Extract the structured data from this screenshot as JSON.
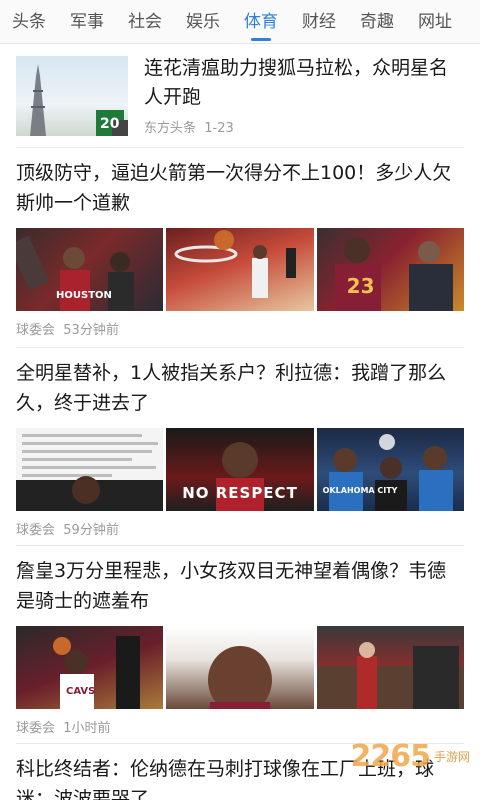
{
  "tabs": [
    {
      "label": "头条",
      "active": false
    },
    {
      "label": "军事",
      "active": false
    },
    {
      "label": "社会",
      "active": false
    },
    {
      "label": "娱乐",
      "active": false
    },
    {
      "label": "体育",
      "active": true
    },
    {
      "label": "财经",
      "active": false
    },
    {
      "label": "奇趣",
      "active": false
    },
    {
      "label": "网址",
      "active": false
    }
  ],
  "articles": [
    {
      "title": "连花清瘟助力搜狐马拉松，众明星名人开跑",
      "source": "东方头条",
      "time": "1-23",
      "thumb_text": "20"
    },
    {
      "title": "顶级防守，逼迫火箭第一次得分不上100！多少人欠斯帅一个道歉",
      "source": "球委会",
      "time": "53分钟前",
      "image_text": [
        "HOUSTON",
        "",
        "23"
      ]
    },
    {
      "title": "全明星替补，1人被指关系户？利拉德：我蹭了那么久，终于进去了",
      "source": "球委会",
      "time": "59分钟前",
      "image_text": [
        "",
        "NO RESPECT",
        "OKLAHOMA CITY"
      ]
    },
    {
      "title": "詹皇3万分里程悲，小女孩双目无神望着偶像？韦德是骑士的遮羞布",
      "source": "球委会",
      "time": "1小时前",
      "image_text": [
        "CAVS",
        "",
        ""
      ]
    },
    {
      "title": "科比终结者：伦纳德在马刺打球像在工厂上班，球迷：波波要哭了"
    }
  ],
  "watermark": {
    "text": "2265",
    "sub": "手游网"
  },
  "colors": {
    "accent": "#2f80d8",
    "meta": "#9a9a9a",
    "divider": "#e8e8e8"
  }
}
